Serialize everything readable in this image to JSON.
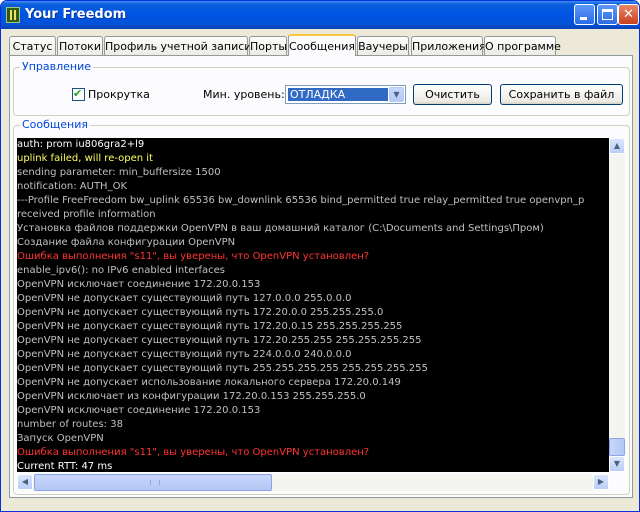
{
  "window": {
    "title": "Your Freedom",
    "icon": "app-icon",
    "controls": [
      "minimize-icon",
      "maximize-icon",
      "close-icon"
    ]
  },
  "tabs": [
    {
      "label": "Статус"
    },
    {
      "label": "Потоки"
    },
    {
      "label": "Профиль учетной записи"
    },
    {
      "label": "Порты"
    },
    {
      "label": "Сообщения",
      "active": true
    },
    {
      "label": "Ваучеры"
    },
    {
      "label": "Приложения"
    },
    {
      "label": "О программе"
    }
  ],
  "control_group": {
    "title": "Управление",
    "scroll_checkbox_label": "Прокрутка",
    "scroll_checked": true,
    "level_label": "Мин. уровень:",
    "level_value": "ОТЛАДКА",
    "clear_button": "Очистить",
    "save_button": "Сохранить в файл"
  },
  "messages_group": {
    "title": "Сообщения",
    "lines": [
      {
        "text": "auth: prom iu806gra2+l9",
        "color": "#ffffff"
      },
      {
        "text": "uplink failed, will re-open it",
        "color": "#ffff66"
      },
      {
        "text": "sending parameter: min_buffersize 1500",
        "color": "#c0c0c0"
      },
      {
        "text": "notification: AUTH_OK",
        "color": "#c0c0c0"
      },
      {
        "text": "---Profile FreeFreedom   bw_uplink      65536   bw_downlink    65536   bind_permitted  true   relay_permitted true   openvpn_p",
        "color": "#c0c0c0"
      },
      {
        "text": "received profile information",
        "color": "#c0c0c0"
      },
      {
        "text": "Установка файлов поддержки OpenVPN в ваш домашний каталог (C:\\Documents and Settings\\Пром)",
        "color": "#c0c0c0"
      },
      {
        "text": "Создание файла конфигурации OpenVPN",
        "color": "#c0c0c0"
      },
      {
        "text": "Ошибка выполнения \"s11\", вы уверены, что OpenVPN установлен?",
        "color": "#ff3333"
      },
      {
        "text": "enable_ipv6(): no IPv6 enabled interfaces",
        "color": "#c0c0c0"
      },
      {
        "text": "OpenVPN исключает соединение 172.20.0.153",
        "color": "#c0c0c0"
      },
      {
        "text": "OpenVPN не допускает существующий путь 127.0.0.0 255.0.0.0",
        "color": "#c0c0c0"
      },
      {
        "text": "OpenVPN не допускает существующий путь 172.20.0.0 255.255.255.0",
        "color": "#c0c0c0"
      },
      {
        "text": "OpenVPN не допускает существующий путь 172.20.0.15 255.255.255.255",
        "color": "#c0c0c0"
      },
      {
        "text": "OpenVPN не допускает существующий путь 172.20.255.255 255.255.255.255",
        "color": "#c0c0c0"
      },
      {
        "text": "OpenVPN не допускает существующий путь 224.0.0.0 240.0.0.0",
        "color": "#c0c0c0"
      },
      {
        "text": "OpenVPN не допускает существующий путь 255.255.255.255 255.255.255.255",
        "color": "#c0c0c0"
      },
      {
        "text": "OpenVPN не допускает использование локального сервера 172.20.0.149",
        "color": "#c0c0c0"
      },
      {
        "text": "OpenVPN исключает из конфигурации 172.20.0.153 255.255.255.0",
        "color": "#c0c0c0"
      },
      {
        "text": "OpenVPN исключает соединение 172.20.0.153",
        "color": "#c0c0c0"
      },
      {
        "text": "number of routes: 38",
        "color": "#c0c0c0"
      },
      {
        "text": "Запуск OpenVPN",
        "color": "#c0c0c0"
      },
      {
        "text": "Ошибка выполнения \"s11\", вы уверены, что OpenVPN установлен?",
        "color": "#ff3333"
      },
      {
        "text": "Current RTT: 47 ms",
        "color": "#ffffff"
      }
    ]
  }
}
